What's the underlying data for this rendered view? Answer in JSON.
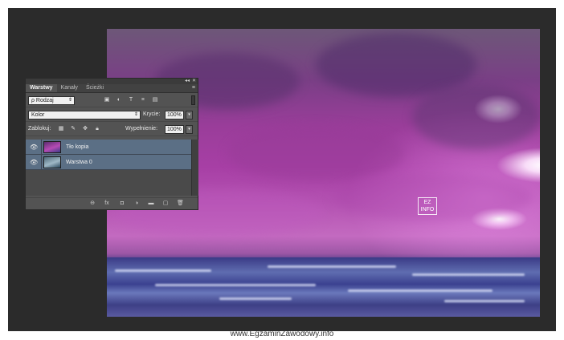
{
  "footer": {
    "url": "www.EgzaminZawodowy.info"
  },
  "watermark": {
    "logo_text": "EZ INFO"
  },
  "panel": {
    "topbar": {
      "collapse_glyph": "◂◂",
      "close_glyph": "✕"
    },
    "tabs": [
      {
        "label": "Warstwy",
        "active": true
      },
      {
        "label": "Kanały",
        "active": false
      },
      {
        "label": "Ścieżki",
        "active": false
      }
    ],
    "menu_glyph": "≡",
    "filter": {
      "label": "ρ Rodzaj",
      "arrows": "⇕"
    },
    "filter_icons": [
      "image-filter-icon",
      "adjustment-filter-icon",
      "type-filter-icon",
      "shape-filter-icon",
      "smart-object-filter-icon"
    ],
    "blend_mode": {
      "value": "Kolor",
      "arrows": "⇕"
    },
    "opacity": {
      "label": "Krycie:",
      "value": "100%"
    },
    "lock": {
      "label": "Zablokuj:"
    },
    "fill": {
      "label": "Wypełnienie:",
      "value": "100%"
    },
    "dropdown_glyph": "▾",
    "layers": [
      {
        "name": "Tło kopia",
        "visible": true
      },
      {
        "name": "Warstwa 0",
        "visible": true
      }
    ],
    "bottom_icons": [
      "link-layers-icon",
      "fx-icon",
      "add-mask-icon",
      "adjustment-layer-icon",
      "new-group-icon",
      "new-layer-icon",
      "delete-layer-icon"
    ],
    "colors": {
      "selected_layer": "#5b6f85",
      "panel_bg": "#535353",
      "workspace_bg": "#2b2b2b"
    }
  }
}
